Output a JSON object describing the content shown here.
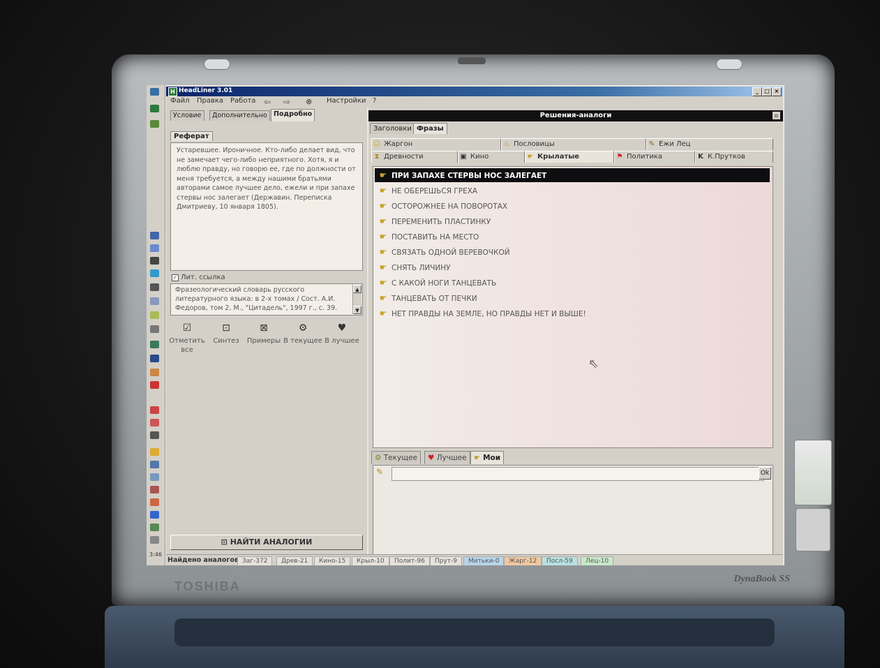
{
  "device": {
    "brand": "TOSHIBA",
    "model": "DynaBook SS"
  },
  "window": {
    "title": "HeadLiner 3.01"
  },
  "menu": {
    "items": [
      "Файл",
      "Правка",
      "Работа",
      "Настройки",
      "?"
    ]
  },
  "left_tabs": [
    {
      "label": "Условие",
      "active": false
    },
    {
      "label": "Дополнительно",
      "active": false
    },
    {
      "label": "Подробно",
      "active": true
    }
  ],
  "referat": {
    "tab_label": "Реферат",
    "text": "Устаревшее. Ироничное. Кто-либо делает вид, что не замечает чего-либо неприятного. Хотя, я и люблю правду, но говорю ее, где по должности от меня требуется, а между нашими братьями авторами самое лучшее дело, ежели и при запахе стервы нос залегает (Державин. Переписка Дмитриеву, 10 января 1805)."
  },
  "lit": {
    "check_label": "Лит. ссылка",
    "checked": true,
    "text": "Фразеологический словарь русского литературного языка: в 2-х томах / Сост. А.И. Федоров, том 2, М., \"Цитадель\", 1997 г., с. 39."
  },
  "actions": [
    {
      "label": "Отметить все",
      "icon": "mark-icon"
    },
    {
      "label": "Синтез",
      "icon": "synthesis-icon"
    },
    {
      "label": "Примеры",
      "icon": "examples-icon"
    },
    {
      "label": "В текущее",
      "icon": "gear-icon"
    },
    {
      "label": "В лучшее",
      "icon": "heart-icon"
    }
  ],
  "find_button": {
    "label": "НАЙТИ АНАЛОГИИ"
  },
  "right": {
    "header": "Решения-аналоги",
    "tabs": [
      {
        "label": "Заголовки",
        "active": false
      },
      {
        "label": "Фразы",
        "active": true
      }
    ],
    "categories_row1": [
      {
        "label": "Жаргон",
        "icon": "smile-icon"
      },
      {
        "label": "Пословицы",
        "icon": "pot-icon"
      },
      {
        "label": "Ежи Лец",
        "icon": "quill-icon"
      }
    ],
    "categories_row2": [
      {
        "label": "Древности",
        "icon": "hourglass-icon",
        "active": false
      },
      {
        "label": "Кино",
        "icon": "film-icon",
        "active": false
      },
      {
        "label": "Крылатые",
        "icon": "hand-icon",
        "active": true
      },
      {
        "label": "Политика",
        "icon": "flag-icon",
        "active": false
      },
      {
        "label": "К.Прутков",
        "icon": "k-icon",
        "active": false
      }
    ],
    "phrases": [
      "ПРИ ЗАПАХЕ СТЕРВЫ НОС ЗАЛЕГАЕТ",
      "НЕ ОБЕРЕШЬСЯ ГРЕХА",
      "ОСТОРОЖНЕЕ НА ПОВОРОТАХ",
      "ПЕРЕМЕНИТЬ ПЛАСТИНКУ",
      "ПОСТАВИТЬ НА МЕСТО",
      "СВЯЗАТЬ ОДНОЙ ВЕРЕВОЧКОЙ",
      "СНЯТЬ ЛИЧИНУ",
      "С КАКОЙ НОГИ ТАНЦЕВАТЬ",
      "ТАНЦЕВАТЬ ОТ ПЕЧКИ",
      "НЕТ ПРАВДЫ НА ЗЕМЛЕ, НО ПРАВДЫ НЕТ И ВЫШЕ!"
    ],
    "selected_index": 0,
    "bottom_tabs": [
      {
        "label": "Текущее",
        "icon": "gear-icon",
        "active": false
      },
      {
        "label": "Лучшее",
        "icon": "heart-icon",
        "active": false
      },
      {
        "label": "Мои",
        "icon": "hand-icon",
        "active": true
      }
    ],
    "ok_label": "Ok"
  },
  "status": {
    "label": "Найдено аналогов:",
    "items": [
      {
        "text": "Заг-372",
        "color": "#e6e2da"
      },
      {
        "text": "Древ-21",
        "color": "#e6e2da"
      },
      {
        "text": "Кино-15",
        "color": "#e6e2da"
      },
      {
        "text": "Крыл-10",
        "color": "#e6e2da"
      },
      {
        "text": "Полит-96",
        "color": "#e6e2da"
      },
      {
        "text": "Прут-9",
        "color": "#e6e2da"
      },
      {
        "text": "Митьки-0",
        "color": "#b8d4e8"
      },
      {
        "text": "Жарг-12",
        "color": "#f0c8a0"
      },
      {
        "text": "Посл-59",
        "color": "#b8e0e0"
      },
      {
        "text": "Лец-10",
        "color": "#c8e8c8"
      }
    ]
  },
  "clock": "3:46"
}
